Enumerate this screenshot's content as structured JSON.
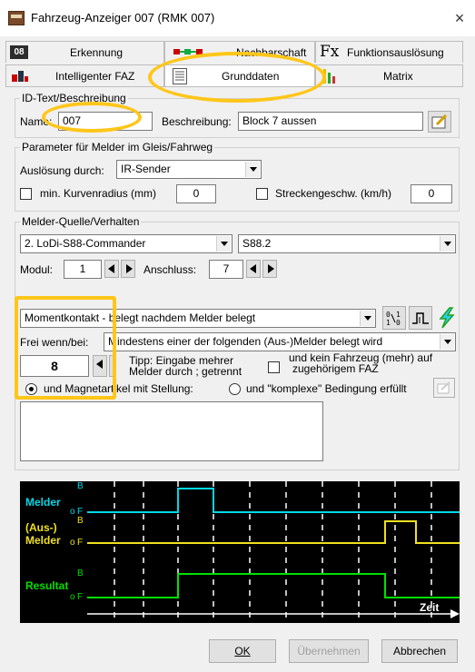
{
  "window": {
    "title": "Fahrzeug-Anzeiger 007 (RMK 007)",
    "close_symbol": "×"
  },
  "tabs": {
    "row1": [
      {
        "icon": "08-icon-box",
        "label": "Erkennung"
      },
      {
        "icon": "neighbourhood-icon",
        "label": "Nachbarschaft"
      },
      {
        "icon": "fx-icon",
        "label": "Funktionsauslösung"
      }
    ],
    "row2": [
      {
        "icon": "intelligent-faz-icon",
        "label": "Intelligenter FAZ"
      },
      {
        "icon": "list-icon",
        "label": "Grunddaten"
      },
      {
        "icon": "matrix-icon",
        "label": "Matrix"
      }
    ],
    "icon_text_08": "08",
    "icon_text_fx": "Fx"
  },
  "id_group": {
    "title": "ID-Text/Beschreibung",
    "name_label": "Name:",
    "name_value": "007",
    "desc_label": "Beschreibung:",
    "desc_value": "Block 7 aussen"
  },
  "param_group": {
    "title": "Parameter für Melder im Gleis/Fahrweg",
    "trigger_label": "Auslösung durch:",
    "trigger_value": "IR-Sender",
    "min_radius_label": "min. Kurvenradius (mm)",
    "min_radius_value": "0",
    "track_speed_label": "Streckengeschw. (km/h)",
    "track_speed_value": "0"
  },
  "source_group": {
    "title": "Melder-Quelle/Verhalten",
    "source_value": "2. LoDi-S88-Commander",
    "bus_value": "S88.2",
    "modul_label": "Modul:",
    "modul_value": "1",
    "anschluss_label": "Anschluss:",
    "anschluss_value": "7",
    "contact_value": "Momentkontakt - belegt nachdem Melder belegt",
    "frei_label": "Frei wenn/bei:",
    "frei_value": "Mindestens einer der folgenden (Aus-)Melder belegt wird",
    "number_value": "8",
    "tip_line1": "Tipp: Eingabe mehrer",
    "tip_line2": "Melder durch ; getrennt",
    "kein_line1": "und kein Fahrzeug (mehr) auf",
    "kein_line2": "zugehörigem FAZ",
    "magnet_label": "und Magnetartikel mit Stellung:",
    "komplex_label": "und \"komplexe\" Bedingung erfüllt"
  },
  "signal": {
    "row1": "Melder",
    "row2a": "(Aus-)",
    "row2b": "Melder",
    "row3": "Resultat",
    "b": "B",
    "f": "F",
    "zeit": "Zeit",
    "colors": {
      "cyan": "#00d8e8",
      "yellow": "#f0e020",
      "green": "#00e000",
      "label": "#f0e020"
    }
  },
  "buttons": {
    "ok": "OK",
    "apply": "Übernehmen",
    "cancel": "Abbrechen"
  },
  "highlight_color": "#ffc61a"
}
